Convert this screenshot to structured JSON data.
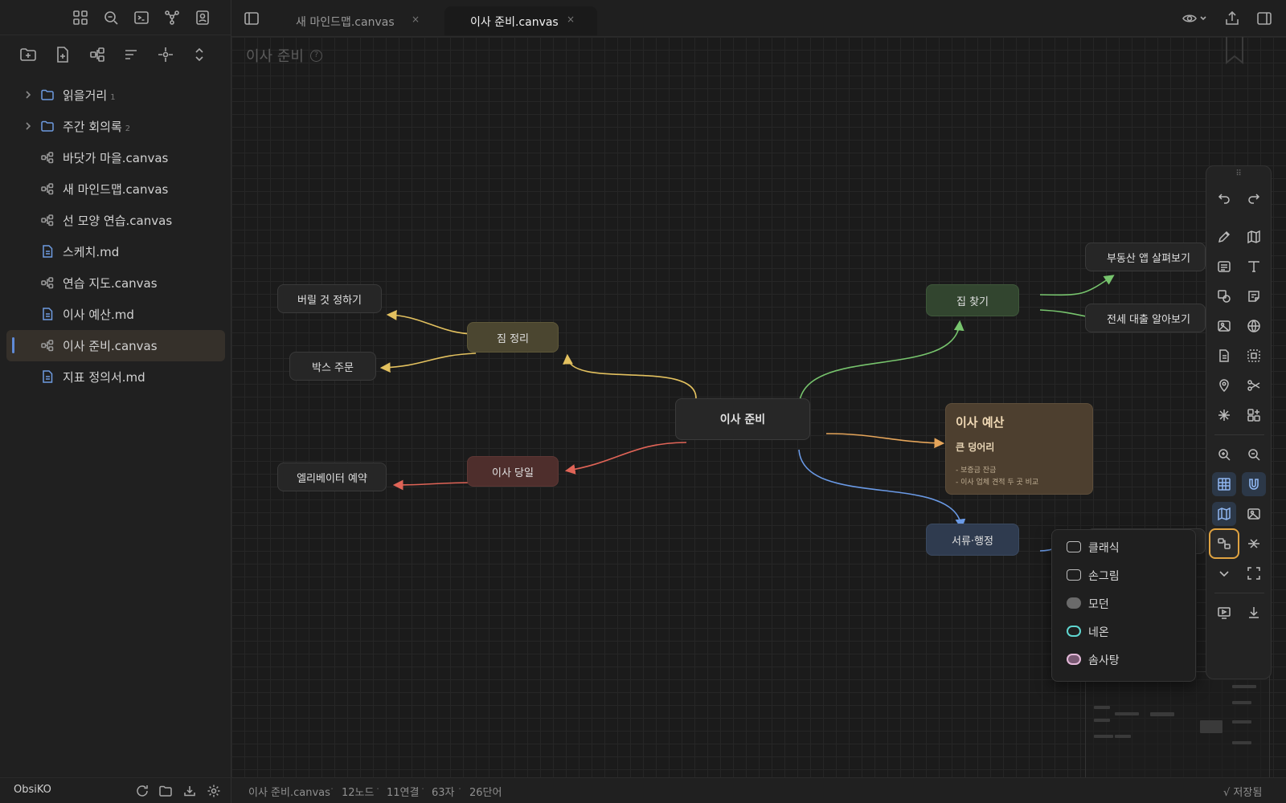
{
  "sidebar": {
    "items": [
      {
        "label": "읽을거리",
        "count": "1",
        "type": "folder"
      },
      {
        "label": "주간 회의록",
        "count": "2",
        "type": "folder"
      },
      {
        "label": "바닷가 마을.canvas",
        "type": "canvas"
      },
      {
        "label": "새 마인드맵.canvas",
        "type": "canvas"
      },
      {
        "label": "선 모양 연습.canvas",
        "type": "canvas"
      },
      {
        "label": "스케치.md",
        "type": "md"
      },
      {
        "label": "연습 지도.canvas",
        "type": "canvas"
      },
      {
        "label": "이사 예산.md",
        "type": "md"
      },
      {
        "label": "이사 준비.canvas",
        "type": "canvas",
        "active": true
      },
      {
        "label": "지표 정의서.md",
        "type": "md"
      }
    ],
    "vault_name": "ObsiKO"
  },
  "tabs": [
    {
      "label": "새 마인드맵.canvas",
      "close": "×"
    },
    {
      "label": "이사 준비.canvas",
      "close": "×",
      "active": true
    }
  ],
  "canvas": {
    "title": "이사 준비",
    "help": "?",
    "nodes": {
      "center": "이사 준비",
      "pack": "짐 정리",
      "discard": "버릴 것 정하기",
      "box": "박스 주문",
      "moving_day": "이사 당일",
      "elevator": "엘리베이터 예약",
      "house": "집 찾기",
      "app": "부동산 앱 살펴보기",
      "loan": "전세 대출 알아보기",
      "docs": "서류·행정"
    },
    "card": {
      "heading": "이사 예산",
      "subheading": "큰 덩어리",
      "items": [
        "- 보증금 잔금",
        "- 이사 업체 견적 두 곳 비교"
      ]
    },
    "edge_colors": {
      "yellow": "#e3c15f",
      "red": "#e06457",
      "green": "#77c46d",
      "orange": "#e5a55a",
      "blue": "#6a9ae6"
    }
  },
  "style_menu": {
    "options": [
      {
        "label": "클래식",
        "swatch": "outline-gray"
      },
      {
        "label": "손그림",
        "swatch": "outline-gray"
      },
      {
        "label": "모던",
        "swatch": "filled-gray"
      },
      {
        "label": "네온",
        "swatch": "outline-cyan"
      },
      {
        "label": "솜사탕",
        "swatch": "pink-filled"
      }
    ]
  },
  "statusbar": {
    "file": "이사 준비.canvas",
    "nodes": "12노드",
    "links": "11연결",
    "chars": "63자",
    "words": "26단어",
    "saved": "√ 저장됨"
  },
  "accent": "#e0a341"
}
